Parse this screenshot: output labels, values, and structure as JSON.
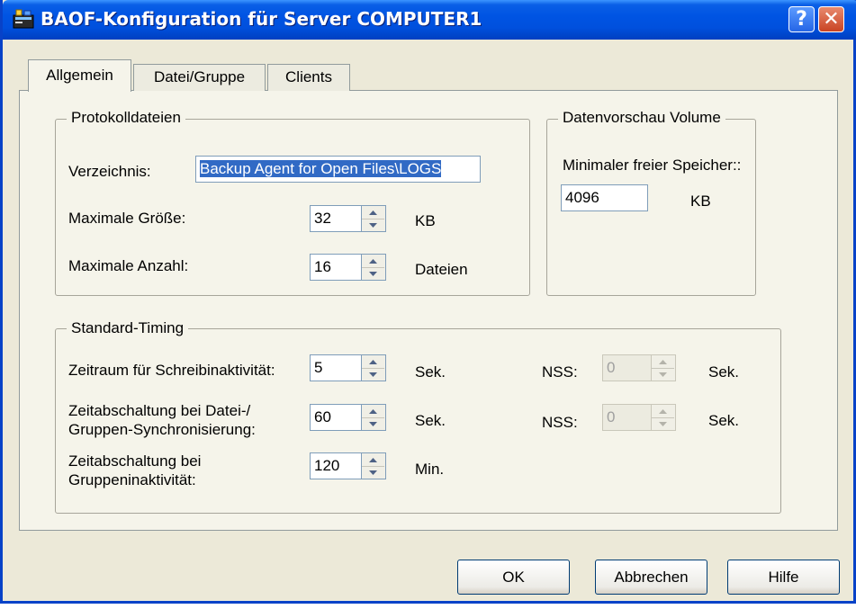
{
  "window": {
    "title": "BAOF-Konfiguration für Server COMPUTER1",
    "help_label": "?",
    "close_label": "✕"
  },
  "tabs": [
    "Allgemein",
    "Datei/Gruppe",
    "Clients"
  ],
  "protokolldateien": {
    "title": "Protokolldateien",
    "verzeichnis_label": "Verzeichnis:",
    "verzeichnis_value": "Backup Agent for Open Files\\LOGS",
    "max_groesse_label": "Maximale Größe:",
    "max_groesse_value": "32",
    "max_groesse_unit": "KB",
    "max_anzahl_label": "Maximale Anzahl:",
    "max_anzahl_value": "16",
    "max_anzahl_unit": "Dateien"
  },
  "datenvorschau": {
    "title": "Datenvorschau Volume",
    "min_speicher_label": "Minimaler freier Speicher::",
    "min_speicher_value": "4096",
    "min_speicher_unit": "KB"
  },
  "timing": {
    "title": "Standard-Timing",
    "row1_label": "Zeitraum für Schreibinaktivität:",
    "row1_value": "5",
    "row1_unit": "Sek.",
    "row1_nss_label": "NSS:",
    "row1_nss_value": "0",
    "row1_nss_unit": "Sek.",
    "row2_label_line1": "Zeitabschaltung bei Datei-/",
    "row2_label_line2": "Gruppen-Synchronisierung:",
    "row2_value": "60",
    "row2_unit": "Sek.",
    "row2_nss_label": "NSS:",
    "row2_nss_value": "0",
    "row2_nss_unit": "Sek.",
    "row3_label_line1": "Zeitabschaltung bei",
    "row3_label_line2": "Gruppeninaktivität:",
    "row3_value": "120",
    "row3_unit": "Min."
  },
  "buttons": {
    "ok": "OK",
    "cancel": "Abbrechen",
    "help": "Hilfe"
  }
}
